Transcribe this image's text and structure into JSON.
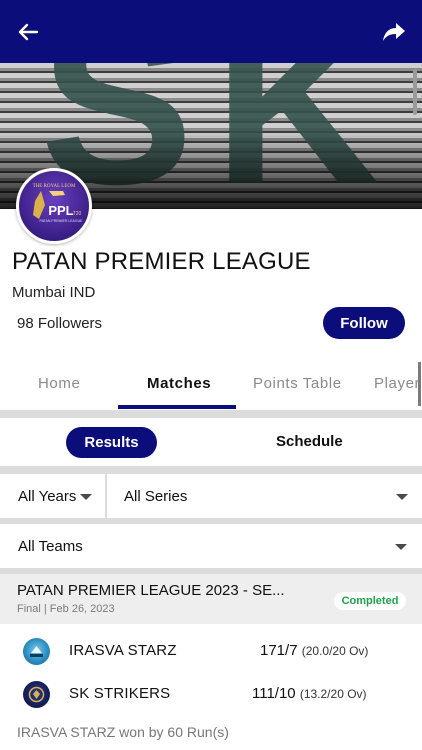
{
  "header": {
    "back_icon": "arrow-left-icon",
    "share_icon": "share-arrow-icon",
    "bar_color": "#0b0d7a"
  },
  "banner": {
    "art_text": "SK",
    "logo_lines": [
      "THE ROYAL LEOM",
      "PPL",
      "T20",
      "PATAN PREMIER LEAGUE"
    ]
  },
  "league": {
    "title": "PATAN PREMIER LEAGUE",
    "location": "Mumbai IND",
    "followers": "98 Followers",
    "follow_label": "Follow"
  },
  "tabs": [
    {
      "label": "Home",
      "active": false
    },
    {
      "label": "Matches",
      "active": true
    },
    {
      "label": "Points Table",
      "active": false
    },
    {
      "label": "Player",
      "active": false
    }
  ],
  "subtabs": {
    "results": "Results",
    "schedule": "Schedule"
  },
  "filters": {
    "years": "All Years",
    "series": "All Series",
    "teams": "All Teams"
  },
  "match": {
    "title": "PATAN PREMIER LEAGUE 2023 - SE...",
    "meta": "Final | Feb 26, 2023",
    "status": "Completed",
    "status_color": "#1fa34a",
    "teams": [
      {
        "name": "IRASVA STARZ",
        "score": "171/7",
        "overs": "(20.0/20 Ov)"
      },
      {
        "name": "SK STRIKERS",
        "score": "111/10",
        "overs": "(13.2/20 Ov)"
      }
    ],
    "result": "IRASVA STARZ won by 60 Run(s)"
  }
}
